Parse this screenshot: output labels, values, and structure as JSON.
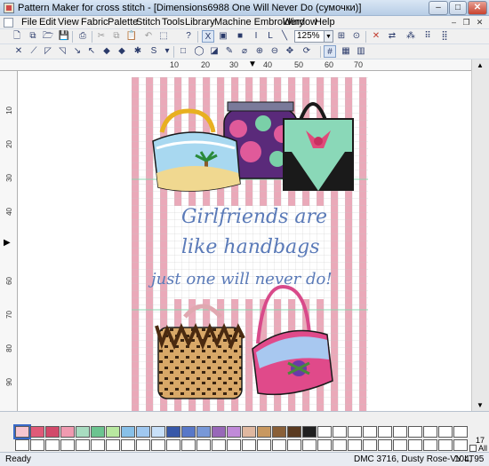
{
  "window": {
    "title": "Pattern Maker for cross stitch - [Dimensions6988 One Will Never Do (сумочки)]",
    "minimize": "–",
    "maximize": "□",
    "close": "✕"
  },
  "menu": {
    "items": [
      "File",
      "Edit",
      "View",
      "Fabric",
      "Palette",
      "Stitch",
      "Tools",
      "Library",
      "Machine Embroidery",
      "Window",
      "Help"
    ],
    "mdi_minimize": "–",
    "mdi_restore": "❐",
    "mdi_close": "✕"
  },
  "toolbar": {
    "zoom_value": "125%",
    "text_tool": "I",
    "line_tool": "L",
    "x_tool": "X",
    "help_tool": "?",
    "row2_s_label": "S"
  },
  "ruler": {
    "h_ticks": [
      "10",
      "20",
      "30",
      "40",
      "50",
      "60",
      "70"
    ],
    "v_ticks": [
      "10",
      "20",
      "30",
      "40",
      "50",
      "60",
      "70",
      "80",
      "90"
    ]
  },
  "pattern": {
    "text_line1": "Girlfriends are",
    "text_line2": "like handbags",
    "text_line3": "just one will never do!",
    "text_color": "#5a7ab8",
    "stripe_color": "#e8a7b8"
  },
  "palette": {
    "colors": [
      "#f7c6d0",
      "#e05a78",
      "#d24a6a",
      "#f09ab0",
      "#a8dcc0",
      "#6cc490",
      "#b8e8a0",
      "#88c0e8",
      "#a0c8f0",
      "#c8e0f8",
      "#3858a8",
      "#5878c8",
      "#7898d8",
      "#9868b8",
      "#c08ad8",
      "#e0b8a0",
      "#c89860",
      "#8a6038",
      "#5a3a20",
      "#202020"
    ],
    "side_count": "17",
    "side_label": "All"
  },
  "status": {
    "left": "Ready",
    "color_info": "DMC  3716, Dusty Rose-VY LT",
    "coords": "104, 95"
  }
}
